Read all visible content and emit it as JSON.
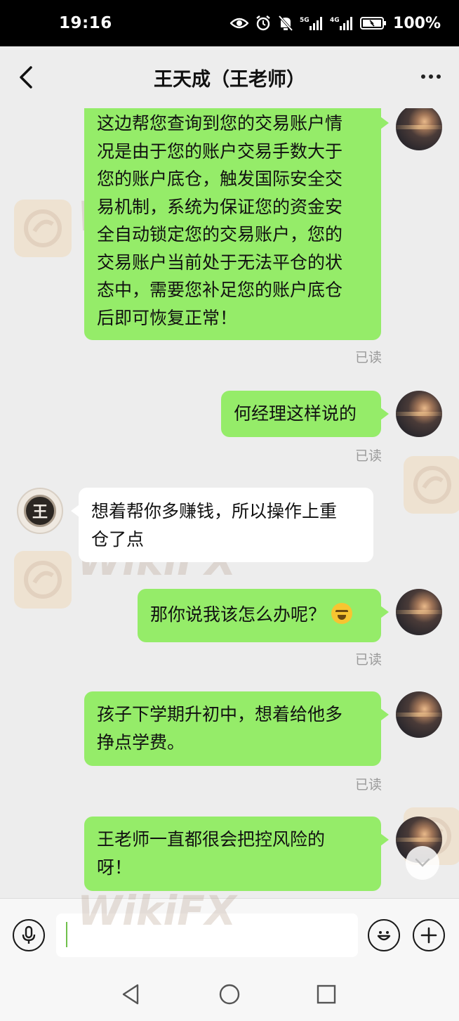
{
  "status_bar": {
    "time": "19:16",
    "battery": "100%",
    "network_1": "5G",
    "network_2": "4G"
  },
  "header": {
    "title": "王天成（王老师）"
  },
  "messages": [
    {
      "sender": "me",
      "lines": [
        "这边帮您查询到您的交易账户情",
        "况是由于您的账户交易手数大于",
        "您的账户底仓，触发国际安全交",
        "易机制，系统为保证您的资金安",
        "全自动锁定您的交易账户，您的",
        "交易账户当前处于无法平仓的状",
        "态中，需要您补足您的账户底仓",
        "后即可恢复正常！"
      ],
      "status": "已读"
    },
    {
      "sender": "me",
      "lines": [
        "何经理这样说的"
      ],
      "status": "已读"
    },
    {
      "sender": "other",
      "avatar_char": "王",
      "lines": [
        "想着帮你多赚钱，所以操作上重",
        "仓了点"
      ]
    },
    {
      "sender": "me",
      "lines": [
        "那你说我该怎么办呢？"
      ],
      "emoji": "crying-face",
      "status": "已读"
    },
    {
      "sender": "me",
      "lines": [
        "孩子下学期升初中，想着给他多",
        "挣点学费。"
      ],
      "status": "已读"
    },
    {
      "sender": "me",
      "lines": [
        "王老师一直都很会把控风险的",
        "呀！"
      ]
    }
  ],
  "watermark": "WikiFX",
  "colors": {
    "my_bubble": "#95ec69",
    "other_bubble": "#ffffff",
    "background": "#ededed"
  }
}
